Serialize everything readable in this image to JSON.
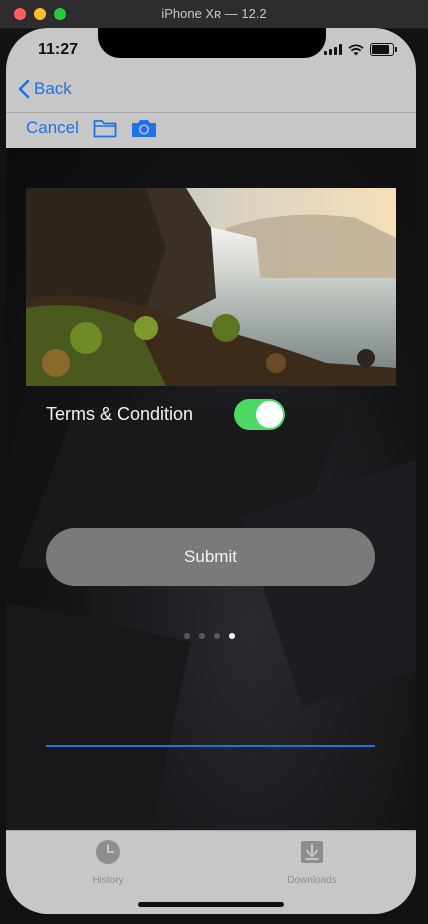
{
  "window": {
    "title": "iPhone Xʀ — 12.2"
  },
  "status_bar": {
    "time": "11:27"
  },
  "nav": {
    "back_label": "Back"
  },
  "toolbar": {
    "cancel_label": "Cancel",
    "icons": [
      "folder-icon",
      "camera-icon"
    ]
  },
  "form": {
    "terms_label": "Terms & Condition",
    "terms_enabled": true,
    "submit_label": "Submit"
  },
  "pager": {
    "page_count": 4,
    "current_index": 3
  },
  "tabbar": {
    "items": [
      {
        "label": "History",
        "icon": "clock-icon"
      },
      {
        "label": "Downloads",
        "icon": "download-icon"
      }
    ]
  },
  "colors": {
    "accent": "#1a73e8",
    "toggle_on": "#4cd964",
    "submit_bg": "#7a7a7a",
    "bar_bg": "#c7c7c7"
  }
}
